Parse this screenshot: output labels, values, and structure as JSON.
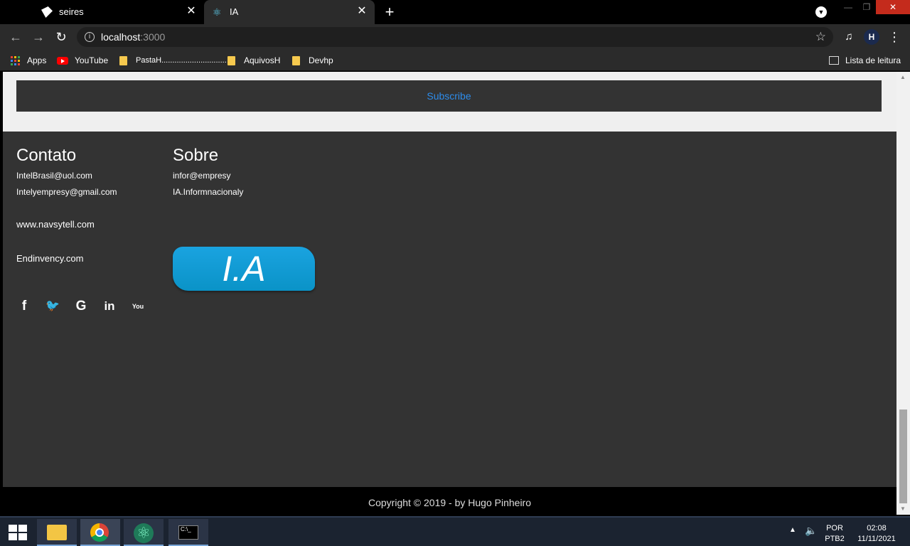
{
  "browser": {
    "tabs": [
      {
        "title": "seires",
        "active": false
      },
      {
        "title": "IA",
        "active": true
      }
    ],
    "new_tab_label": "+",
    "url": {
      "host": "localhost",
      "port": ":3000"
    },
    "bookmarks": [
      {
        "label": "Apps",
        "icon": "apps-grid-icon"
      },
      {
        "label": "YouTube",
        "icon": "youtube-icon"
      },
      {
        "label": "PastaH..............................",
        "icon": "folder-icon"
      },
      {
        "label": "AquivosH",
        "icon": "folder-icon"
      },
      {
        "label": "Devhp",
        "icon": "folder-icon"
      }
    ],
    "reading_list_label": "Lista de leitura",
    "profile_initial": "H"
  },
  "page": {
    "subscribe_label": "Subscribe",
    "contato": {
      "title": "Contato",
      "emails": [
        "IntelBrasil@uol.com",
        "Intelyempresy@gmail.com"
      ],
      "links": [
        "www.navsytell.com",
        "Endinvency.com"
      ]
    },
    "sobre": {
      "title": "Sobre",
      "items": [
        "infor@empresy",
        "IA.Informnacionaly"
      ],
      "logo_text": "I.A"
    },
    "social": [
      {
        "name": "facebook-icon",
        "glyph": "f"
      },
      {
        "name": "twitter-icon",
        "glyph": "🐦"
      },
      {
        "name": "google-icon",
        "glyph": "G"
      },
      {
        "name": "linkedin-icon",
        "glyph": "in"
      },
      {
        "name": "youtube-icon",
        "glyph": "You"
      }
    ],
    "copyright": "Copyright © 2019 - by Hugo Pinheiro"
  },
  "taskbar": {
    "language": "POR",
    "layout": "PTB2",
    "time": "02:08",
    "date": "11/11/2021"
  },
  "colors": {
    "accent_link": "#2d8ceb",
    "footer_bg": "#333333",
    "logo_blue": "#0a93c7"
  }
}
